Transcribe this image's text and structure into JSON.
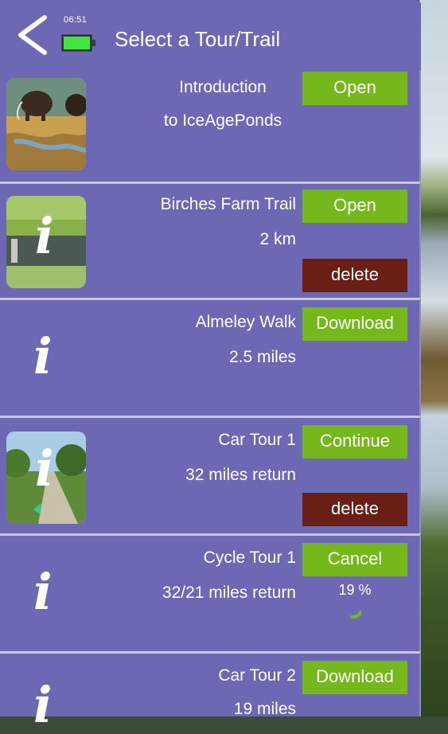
{
  "header": {
    "time": "06:51",
    "title": "Select a Tour/Trail",
    "back_icon": "chevron-left-icon",
    "battery_icon": "battery-icon"
  },
  "colors": {
    "panel": "#6d68b3",
    "button_green": "#74b81b",
    "button_delete": "#6b1e13",
    "separator": "#c7c6df"
  },
  "tours": [
    {
      "name": "Introduction",
      "subtitle": "to IceAgePonds",
      "action": "Open",
      "thumbnail": "mammoth-image"
    },
    {
      "name": "Birches Farm Trail",
      "distance": "2 km",
      "action": "Open",
      "secondary_action": "delete",
      "thumbnail": "pond-image"
    },
    {
      "name": "Almeley Walk",
      "distance": "2.5 miles",
      "action": "Download",
      "thumbnail": "info-icon"
    },
    {
      "name": "Car Tour 1",
      "distance": "32 miles return",
      "action": "Continue",
      "secondary_action": "delete",
      "thumbnail": "road-image"
    },
    {
      "name": "Cycle Tour 1",
      "distance": "32/21 miles return",
      "action": "Cancel",
      "progress_text": "19 %",
      "progress": 0.19,
      "thumbnail": "info-icon"
    },
    {
      "name": "Car Tour 2",
      "distance": "19 miles",
      "action": "Download",
      "thumbnail": "info-icon"
    }
  ]
}
